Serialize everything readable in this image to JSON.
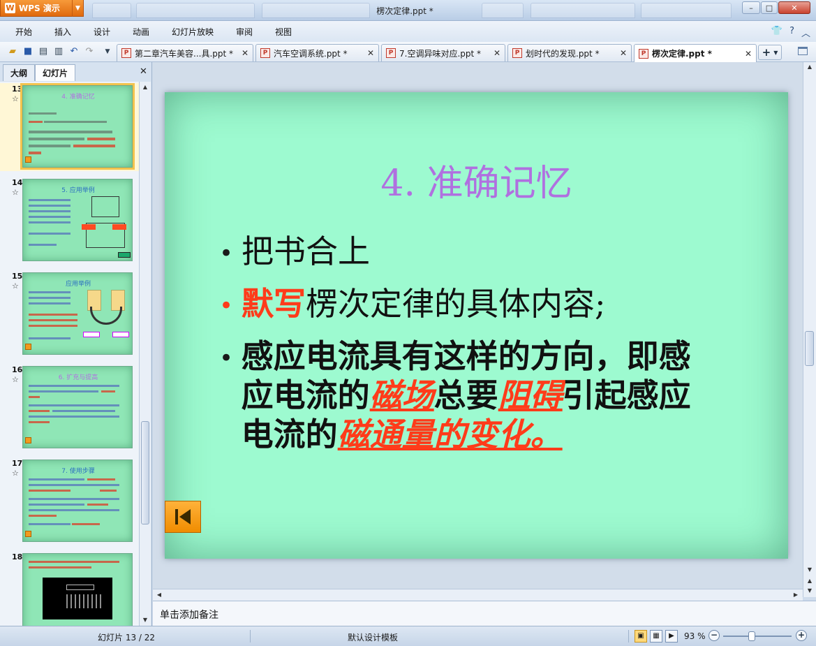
{
  "window": {
    "app_button": "WPS 演示",
    "title": "楞次定律.ppt *"
  },
  "menu": [
    "开始",
    "插入",
    "设计",
    "动画",
    "幻灯片放映",
    "审阅",
    "视图"
  ],
  "doc_tabs": [
    {
      "label": "第二章汽车美容...具.ppt *",
      "active": false
    },
    {
      "label": "汽车空调系统.ppt *",
      "active": false
    },
    {
      "label": "7.空调异味对应.ppt *",
      "active": false
    },
    {
      "label": "划时代的发现.ppt *",
      "active": false
    },
    {
      "label": "楞次定律.ppt *",
      "active": true
    }
  ],
  "left_panel": {
    "tabs": [
      "大纲",
      "幻灯片"
    ],
    "active_tab": "幻灯片",
    "thumbnails": [
      {
        "number": "13",
        "title": "4. 准确记忆",
        "selected": true
      },
      {
        "number": "14",
        "title": "5. 应用举例",
        "selected": false
      },
      {
        "number": "15",
        "title": "应用举例",
        "selected": false
      },
      {
        "number": "16",
        "title": "6. 扩充与提高",
        "selected": false
      },
      {
        "number": "17",
        "title": "7. 使用步骤",
        "selected": false
      },
      {
        "number": "18",
        "title": "",
        "selected": false
      }
    ]
  },
  "slide": {
    "title": "4. 准确记忆",
    "bullet1": "把书合上",
    "bullet2_red": "默写",
    "bullet2_rest": "楞次定律的具体内容;",
    "bullet3_p1": "感应电流具有这样的方向，即感应电流的",
    "bullet3_em1": "磁场",
    "bullet3_p2": "总要",
    "bullet3_em2": "阻碍",
    "bullet3_p3": "引起感应电流的",
    "bullet3_em3": "磁通量的变化。",
    "colors": {
      "background": "#9dfad0",
      "title": "#b070e0",
      "accent_red": "#ff3b1a"
    }
  },
  "notes": {
    "placeholder": "单击添加备注"
  },
  "status": {
    "slide_counter": "幻灯片 13 / 22",
    "template": "默认设计模板",
    "zoom": "93 %",
    "zoom_fraction": 0.42
  }
}
